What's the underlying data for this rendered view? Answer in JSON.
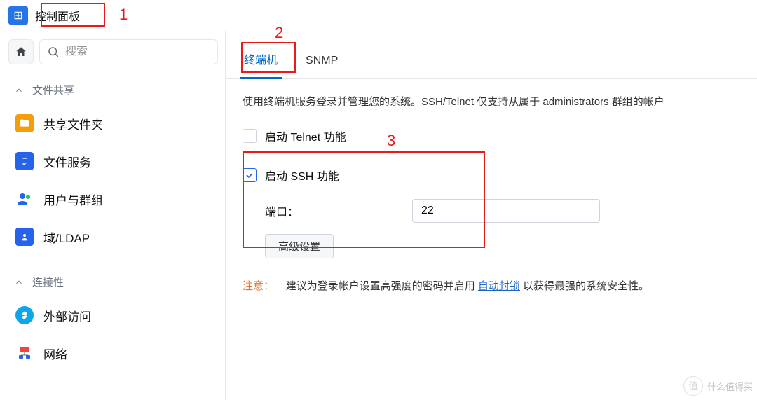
{
  "title": "控制面板",
  "search": {
    "placeholder": "搜索"
  },
  "sidebar": {
    "sections": [
      {
        "label": "文件共享"
      },
      {
        "label": "连接性"
      }
    ],
    "items_file": [
      {
        "label": "共享文件夹"
      },
      {
        "label": "文件服务"
      },
      {
        "label": "用户与群组"
      },
      {
        "label": "域/LDAP"
      }
    ],
    "items_conn": [
      {
        "label": "外部访问"
      },
      {
        "label": "网络"
      }
    ]
  },
  "tabs": [
    {
      "label": "终端机"
    },
    {
      "label": "SNMP"
    }
  ],
  "main": {
    "description": "使用终端机服务登录并管理您的系统。SSH/Telnet 仅支持从属于 administrators 群组的帐户",
    "telnet_label": "启动 Telnet 功能",
    "ssh_label": "启动 SSH 功能",
    "port_label": "端口：",
    "port_value": "22",
    "advanced_btn": "高级设置",
    "note_label": "注意：",
    "note_before": "建议为登录帐户设置高强度的密码并启用 ",
    "note_link": "自动封锁",
    "note_after": " 以获得最强的系统安全性。"
  },
  "annotations": {
    "n1": "1",
    "n2": "2",
    "n3": "3"
  },
  "watermark": {
    "circle": "值",
    "text": "什么值得买"
  }
}
